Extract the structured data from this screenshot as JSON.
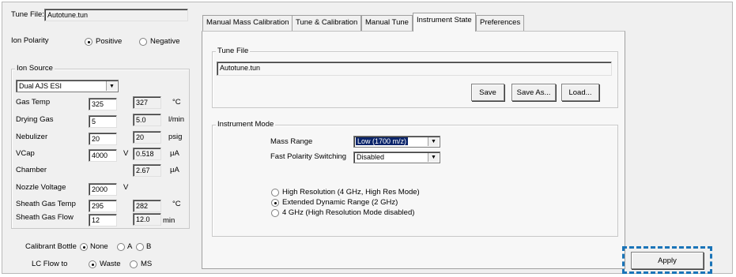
{
  "left_panel": {
    "tune_file_label": "Tune File:",
    "tune_file_value": "Autotune.tun",
    "ion_polarity_label": "Ion Polarity",
    "polarity_positive": "Positive",
    "polarity_negative": "Negative",
    "polarity_selected": "Positive"
  },
  "ion_source": {
    "title": "Ion Source",
    "source_selected": "Dual AJS ESI",
    "rows": [
      {
        "label": "Gas Temp",
        "setpoint": "325",
        "actual": "327",
        "unit": "°C"
      },
      {
        "label": "Drying Gas",
        "setpoint": "5",
        "actual": "5.0",
        "unit": "l/min"
      },
      {
        "label": "Nebulizer",
        "setpoint": "20",
        "actual": "20",
        "unit": "psig"
      },
      {
        "label": "VCap",
        "setpoint": "4000",
        "setpoint_unit": "V",
        "actual": "0.518",
        "unit": "μA"
      },
      {
        "label": "Chamber",
        "setpoint": "",
        "actual": "2.67",
        "unit": "μA"
      },
      {
        "label": "Nozzle Voltage",
        "setpoint": "2000",
        "setpoint_unit": "V",
        "actual": "",
        "unit": ""
      },
      {
        "label": "Sheath Gas Temp",
        "setpoint": "295",
        "actual": "282",
        "unit": "°C"
      },
      {
        "label": "Sheath Gas Flow",
        "setpoint": "12",
        "actual": "12.0",
        "unit": "min"
      }
    ]
  },
  "bottom_left": {
    "calibrant_label": "Calibrant Bottle",
    "calibrant_options": [
      "None",
      "A",
      "B"
    ],
    "calibrant_selected": "None",
    "lcflow_label": "LC Flow to",
    "lcflow_options": [
      "Waste",
      "MS"
    ],
    "lcflow_selected": "Waste"
  },
  "tabs": [
    {
      "label": "Manual Mass Calibration",
      "active": false
    },
    {
      "label": "Tune & Calibration",
      "active": false
    },
    {
      "label": "Manual Tune",
      "active": false
    },
    {
      "label": "Instrument State",
      "active": true
    },
    {
      "label": "Preferences",
      "active": false
    }
  ],
  "tune_file_group": {
    "title": "Tune File",
    "value": "Autotune.tun",
    "save_label": "Save",
    "save_as_label": "Save As...",
    "load_label": "Load..."
  },
  "instrument_mode": {
    "title": "Instrument Mode",
    "mass_range_label": "Mass Range",
    "mass_range_value": "Low (1700 m/z)",
    "fast_polarity_label": "Fast Polarity Switching",
    "fast_polarity_value": "Disabled",
    "modes": [
      {
        "label": "High Resolution (4 GHz, High Res Mode)",
        "selected": false
      },
      {
        "label": "Extended Dynamic Range (2 GHz)",
        "selected": true
      },
      {
        "label": "4 GHz (High Resolution Mode disabled)",
        "selected": false
      }
    ]
  },
  "apply_label": "Apply",
  "colors": {
    "highlight": "#1a74b8",
    "selection": "#0a246a"
  }
}
